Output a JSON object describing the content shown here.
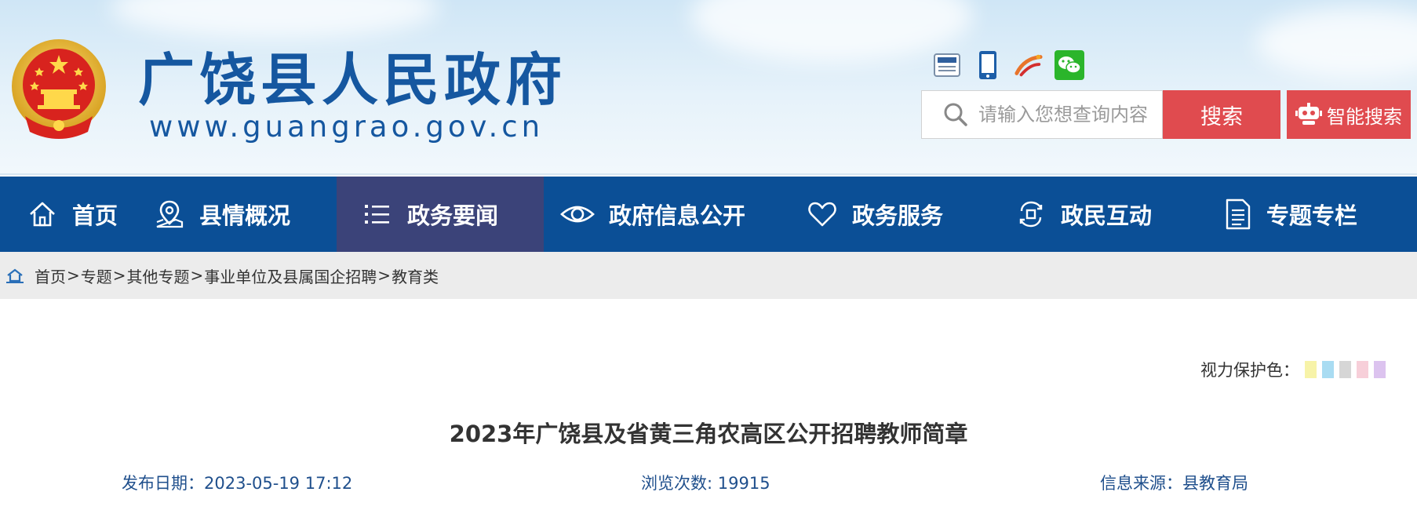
{
  "header": {
    "site_title": "广饶县人民政府",
    "site_url": "www.guangrao.gov.cn",
    "top_icons": [
      "gov-app-icon",
      "mobile-icon",
      "weibo-icon",
      "wechat-icon"
    ],
    "search_placeholder": "请输入您想查询内容",
    "search_button": "搜索",
    "smart_search_button": "智能搜索"
  },
  "nav": {
    "items": [
      {
        "label": "首页",
        "icon": "home-icon"
      },
      {
        "label": "县情概况",
        "icon": "map-pin-icon"
      },
      {
        "label": "政务要闻",
        "icon": "list-icon",
        "active": true
      },
      {
        "label": "政府信息公开",
        "icon": "eye-icon"
      },
      {
        "label": "政务服务",
        "icon": "heart-icon"
      },
      {
        "label": "政民互动",
        "icon": "interaction-icon"
      },
      {
        "label": "专题专栏",
        "icon": "document-icon"
      }
    ]
  },
  "breadcrumb": {
    "items": [
      "首页",
      "专题",
      "其他专题",
      "事业单位及县属国企招聘",
      "教育类"
    ],
    "separator": ">"
  },
  "eye_care": {
    "label": "视力保护色：",
    "colors": [
      "#f7f3a8",
      "#a9dcf2",
      "#d6d6d6",
      "#f7cfd9",
      "#dcc3ef"
    ]
  },
  "article": {
    "title": "2023年广饶县及省黄三角农高区公开招聘教师简章",
    "publish_date": "发布日期：2023-05-19 17:12",
    "views": "浏览次数: 19915",
    "source": "信息来源：县教育局"
  },
  "colors": {
    "nav_bg": "#0b4f96",
    "nav_active_bg": "#3b4379",
    "title_blue": "#1557a0",
    "search_red": "#e04b4f",
    "meta_blue": "#1f4f8c"
  }
}
